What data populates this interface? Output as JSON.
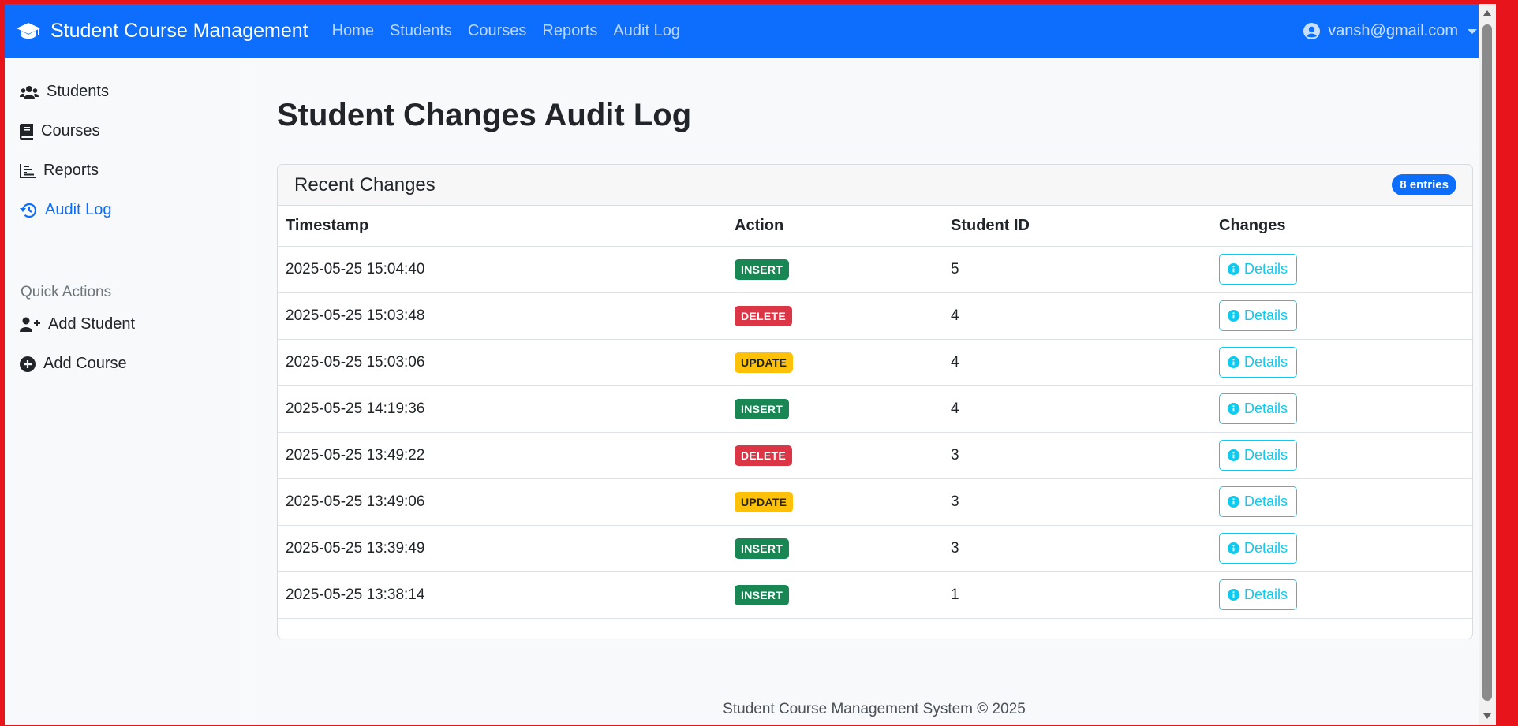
{
  "navbar": {
    "brand": "Student Course Management",
    "links": [
      "Home",
      "Students",
      "Courses",
      "Reports",
      "Audit Log"
    ],
    "user": "vansh@gmail.com"
  },
  "sidebar": {
    "items": [
      {
        "label": "Students",
        "icon": "users-icon"
      },
      {
        "label": "Courses",
        "icon": "book-icon"
      },
      {
        "label": "Reports",
        "icon": "chart-icon"
      },
      {
        "label": "Audit Log",
        "icon": "history-icon",
        "active": true
      }
    ],
    "quick_actions_heading": "Quick Actions",
    "quick_actions": [
      {
        "label": "Add Student",
        "icon": "user-plus-icon"
      },
      {
        "label": "Add Course",
        "icon": "plus-circle-icon"
      }
    ]
  },
  "main": {
    "title": "Student Changes Audit Log",
    "card_title": "Recent Changes",
    "entries_badge": "8 entries",
    "columns": [
      "Timestamp",
      "Action",
      "Student ID",
      "Changes"
    ],
    "details_label": "Details",
    "rows": [
      {
        "timestamp": "2025-05-25 15:04:40",
        "action": "INSERT",
        "student_id": "5"
      },
      {
        "timestamp": "2025-05-25 15:03:48",
        "action": "DELETE",
        "student_id": "4"
      },
      {
        "timestamp": "2025-05-25 15:03:06",
        "action": "UPDATE",
        "student_id": "4"
      },
      {
        "timestamp": "2025-05-25 14:19:36",
        "action": "INSERT",
        "student_id": "4"
      },
      {
        "timestamp": "2025-05-25 13:49:22",
        "action": "DELETE",
        "student_id": "3"
      },
      {
        "timestamp": "2025-05-25 13:49:06",
        "action": "UPDATE",
        "student_id": "3"
      },
      {
        "timestamp": "2025-05-25 13:39:49",
        "action": "INSERT",
        "student_id": "3"
      },
      {
        "timestamp": "2025-05-25 13:38:14",
        "action": "INSERT",
        "student_id": "1"
      }
    ]
  },
  "footer": "Student Course Management System © 2025",
  "colors": {
    "primary": "#0d6efd",
    "insert": "#198754",
    "delete": "#dc3545",
    "update": "#ffc107",
    "info": "#0dcaf0"
  }
}
